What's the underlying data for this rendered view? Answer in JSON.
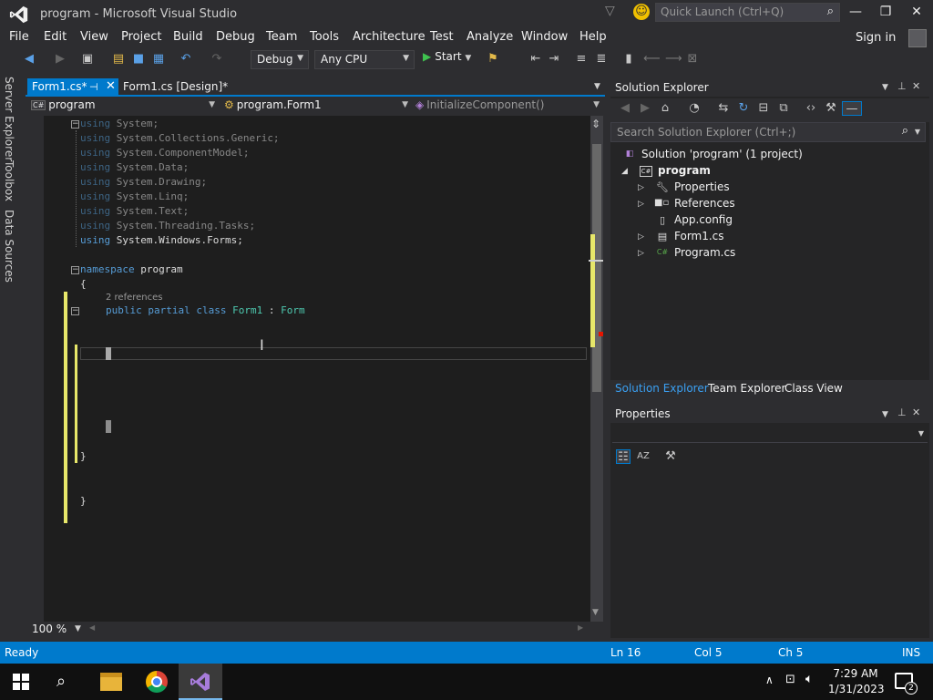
{
  "window": {
    "title": "program - Microsoft Visual Studio",
    "quick_launch_placeholder": "Quick Launch (Ctrl+Q)",
    "sign_in": "Sign in"
  },
  "menu": [
    "File",
    "Edit",
    "View",
    "Project",
    "Build",
    "Debug",
    "Team",
    "Tools",
    "Architecture",
    "Test",
    "Analyze",
    "Window",
    "Help"
  ],
  "toolbar": {
    "configuration": "Debug",
    "platform": "Any CPU",
    "start_label": "Start"
  },
  "left_strip": [
    "Server Explorer",
    "Toolbox",
    "Data Sources"
  ],
  "doc_tabs": [
    {
      "label": "Form1.cs*",
      "active": true
    },
    {
      "label": "Form1.cs [Design]*",
      "active": false
    }
  ],
  "nav_bar": {
    "project_badge": "C#",
    "project": "program",
    "type": "program.Form1",
    "member": "InitializeComponent()"
  },
  "code": {
    "using_kw": "using",
    "usings": [
      "System;",
      "System.Collections.Generic;",
      "System.ComponentModel;",
      "System.Data;",
      "System.Drawing;",
      "System.Linq;",
      "System.Text;",
      "System.Threading.Tasks;",
      "System.Windows.Forms;"
    ],
    "namespace_kw": "namespace",
    "namespace_name": "program",
    "open_brace": "{",
    "close_brace": "}",
    "codelens": "2 references",
    "class_kw": "public partial class",
    "class_name": "Form1",
    "class_sep": ":",
    "base_class": "Form"
  },
  "editor": {
    "zoom": "100 %"
  },
  "solution_explorer": {
    "title": "Solution Explorer",
    "search_placeholder": "Search Solution Explorer (Ctrl+;)",
    "solution": "Solution 'program' (1 project)",
    "project": "program",
    "project_badge": "C#",
    "items": [
      {
        "label": "Properties",
        "expandable": true
      },
      {
        "label": "References",
        "expandable": true
      },
      {
        "label": "App.config",
        "expandable": false
      },
      {
        "label": "Form1.cs",
        "expandable": true
      },
      {
        "label": "Program.cs",
        "expandable": true
      }
    ],
    "file_badge": "C#",
    "tabs": [
      "Solution Explorer",
      "Team Explorer",
      "Class View"
    ]
  },
  "properties": {
    "title": "Properties"
  },
  "status": {
    "state": "Ready",
    "line": "Ln 16",
    "col": "Col 5",
    "ch": "Ch 5",
    "mode": "INS"
  },
  "taskbar": {
    "time": "7:29 AM",
    "date": "1/31/2023",
    "notifications": "2"
  },
  "colors": {
    "accent": "#007acc",
    "keyword": "#569cd6",
    "type": "#4ec9b0",
    "changed_marker": "#e7e76a",
    "saved_marker": "#57a64a"
  }
}
